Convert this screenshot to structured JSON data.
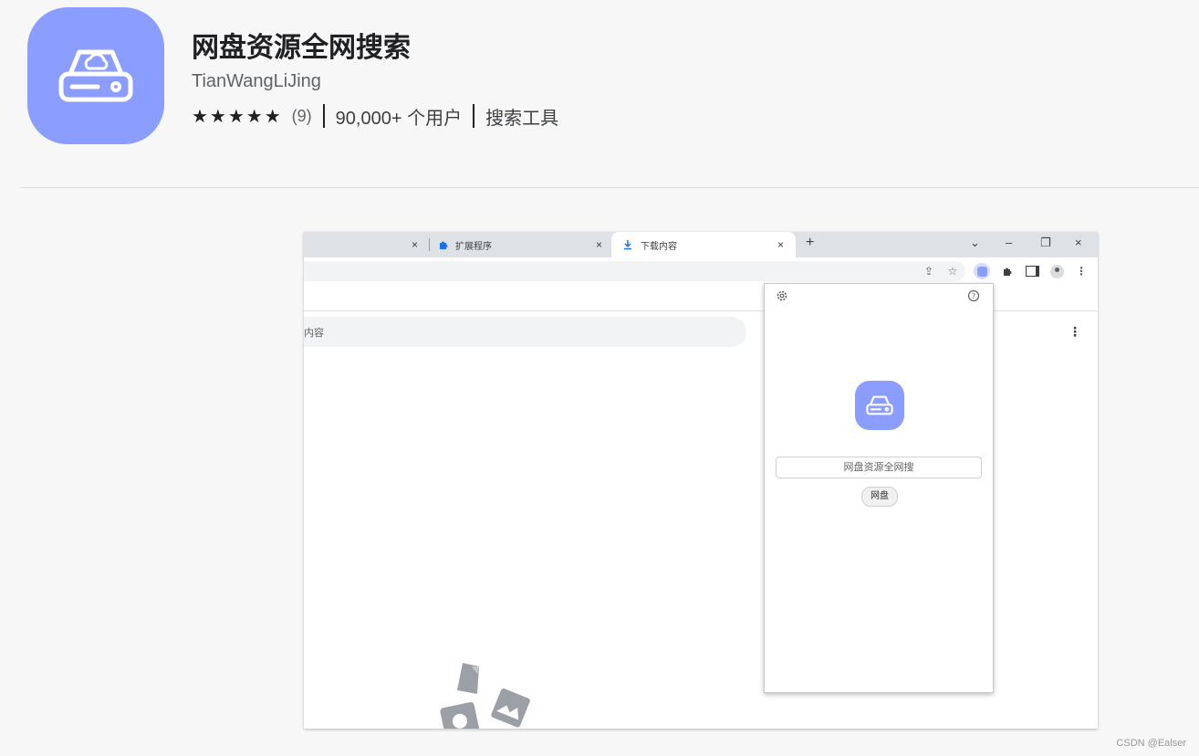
{
  "extension": {
    "title": "网盘资源全网搜索",
    "author": "TianWangLiJing",
    "stars": "★★★★★",
    "rating_count": "(9)",
    "users": "90,000+ 个用户",
    "category": "搜索工具",
    "icon": "cloud-drive-icon",
    "accent_color": "#8b9dff"
  },
  "screenshot": {
    "tabs": [
      {
        "label": "扩展程序",
        "icon": "puzzle-icon"
      },
      {
        "label": "下载内容",
        "icon": "download-icon"
      }
    ],
    "tab_close": "×",
    "new_tab": "+",
    "window_controls": {
      "dropdown": "⌄",
      "minimize": "–",
      "restore": "❐",
      "close": "×"
    },
    "search_placeholder": "内容",
    "popup": {
      "input_placeholder": "网盘资源全网搜",
      "button_label": "网盘",
      "settings_icon": "gear-icon",
      "help_icon": "help-icon"
    }
  },
  "watermark": "CSDN @Ealser"
}
